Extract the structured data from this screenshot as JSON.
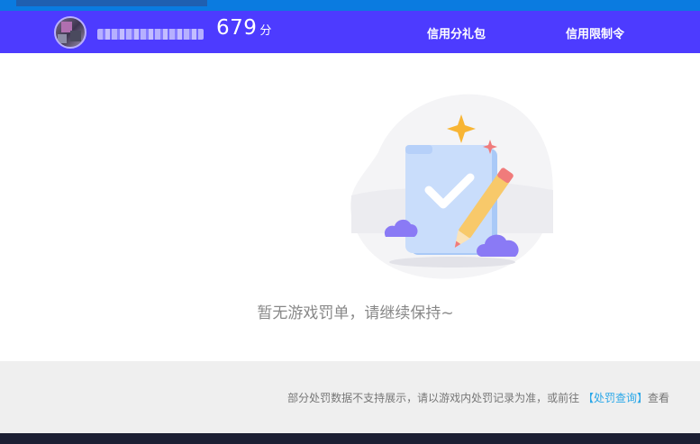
{
  "header": {
    "score_value": "679",
    "score_unit": "分",
    "nav": {
      "gift": "信用分礼包",
      "limit": "信用限制令"
    }
  },
  "main": {
    "empty_message": "暂无游戏罚单，请继续保持~"
  },
  "footer": {
    "note_prefix": "部分处罚数据不支持展示，请以游戏内处罚记录为准，或前往",
    "link": "【处罚查询】",
    "note_suffix": "查看"
  },
  "colors": {
    "header_bg": "#4d3bff",
    "top_strip": "#0a7be0",
    "link": "#2aa7e8",
    "footer_bg": "#efefef",
    "bottom_bar": "#1c1f33"
  },
  "icons": [
    "avatar",
    "empty-record-illustration",
    "pencil-icon",
    "checkmark-icon",
    "sparkle-icon",
    "cloud-icon"
  ]
}
